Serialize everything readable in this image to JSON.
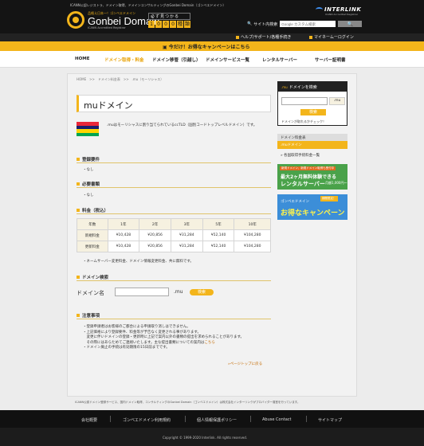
{
  "header": {
    "topline": "ICANN公認レジストラ、ドメイン取得、ドメインコンサルティングのGonbei Domain（ゴンベエドメイン）",
    "logo_sub": "品格え日本一！ゴンベエドメイン",
    "logo_main": "Gonbei Domain",
    "logo_tag": "ICANN Accredited Registrar",
    "count_top": "必ず見つかる",
    "count_digits": [
      "1",
      "0",
      "0",
      "0",
      "種",
      "類"
    ],
    "brand_name": "INTERLINK",
    "brand_sub": "ICANN Accredited Registrar",
    "search_label": "サイト内検索",
    "search_placeholder": "Google カスタム検索",
    "search_button": "🔍"
  },
  "util": {
    "help": "ヘルプ/サポート/各種手続き",
    "mypage": "マイネームーログイン"
  },
  "campaign": {
    "text": "今だけ！お得なキャンペーンはこちら"
  },
  "nav": {
    "items": [
      "HOME",
      "ドメイン取得・料金",
      "ドメイン移管（引越し）",
      "ドメインサービス一覧",
      "レンタルサーバー",
      "サーバー証明書"
    ]
  },
  "breadcrumb": "HOME　>>　ドメイン料金表　>>　.mu（モーリシャス）",
  "page": {
    "title": "muドメイン",
    "intro": ".muはモーリシャスに割り当てられているccTLD（国別コードトップレベルドメイン）です。",
    "flag_colors": [
      "#ea2839",
      "#1a206d",
      "#ffd500",
      "#00a551"
    ]
  },
  "sections": {
    "req_title": "登録要件",
    "req_body": "・なし",
    "docs_title": "必要書類",
    "docs_body": "・なし",
    "fee_title": "料金（税込）",
    "fee_note": "・ネームサーバー変更料金、ドメイン情報変更料金、共に無料です。",
    "search_title": "ドメイン検索",
    "search_label": "ドメイン名",
    "search_ext": ".mu",
    "search_button": "検索",
    "notes_title": "注意事項",
    "notes": [
      "・登録申請者はお客様のご都合による申請取り消しはできません。",
      "・上記価格により登録要件、料金等が予告なく変更される事があります。",
      "　変更に伴いドメインの登録・更新時に上記で案内以外の書類の提出を求められることがあります。",
      "　その際にはあらためてご連絡いたします。主な提出書類についての案内は"
    ],
    "notes_link": "こちら",
    "notes_last": "・ドメイン廃止の手続は有効期限の15日前までです。",
    "page_top": "»ページトップに戻る"
  },
  "price_table": {
    "headers": [
      "年数",
      "1年",
      "2年",
      "3年",
      "5年",
      "10年"
    ],
    "rows": [
      {
        "label": "新規料金",
        "values": [
          "¥10,428",
          "¥20,856",
          "¥31,284",
          "¥52,140",
          "¥104,280"
        ]
      },
      {
        "label": "更新料金",
        "values": [
          "¥10,428",
          "¥20,856",
          "¥31,284",
          "¥52,140",
          "¥104,280"
        ]
      }
    ]
  },
  "sidebar": {
    "search_head": "ドメインを検索",
    "search_ext": ".mu",
    "search_button": "検索",
    "search_hint": "ドメインが取れるかチェック！",
    "list_head": "ドメイン料金表",
    "list_active": ".muドメイン",
    "list_item": "» 各国取得手続料金一覧",
    "banner1_top": "新規ドメイン、新規ドメイン取得も受付中",
    "banner1_main": "最大2ヶ月無料体験できる",
    "banner1_sub": "レンタルサーバー",
    "banner1_price": "月額1,000円～",
    "banner2_badge": "期間限定！",
    "banner2_top": "ゴンベエドメイン",
    "banner2_main": "お得なキャンペーン"
  },
  "footer": {
    "text": "ICANN公認ドメイン登録サービス、国内ドメイン取得、コンサルティングのGonbei Domain（ゴンベエドメイン）は株式会社インターリンクがプロバイダー運営を行っています。",
    "links": [
      "会社概要",
      "ゴンベエドメイン利用規約",
      "個人情報保護ポリシー",
      "Abuse Contact",
      "サイトマップ"
    ],
    "copyright": "Copyright © 1999-2020 Interlink. All rights reserved."
  }
}
